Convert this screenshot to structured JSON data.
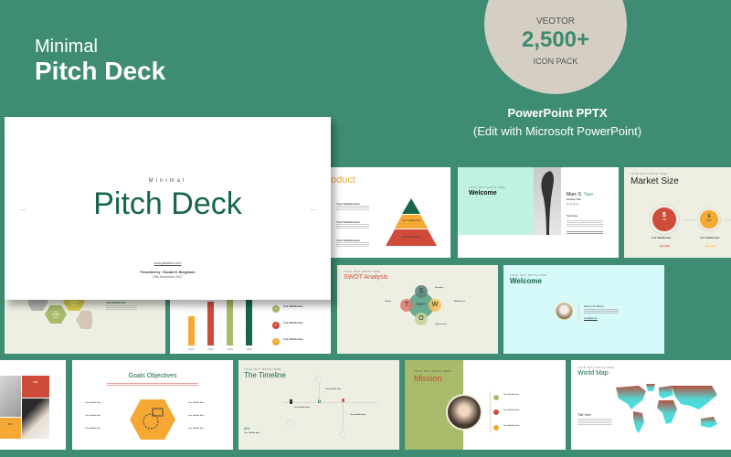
{
  "header": {
    "line1": "Minimal",
    "line2": "Pitch Deck"
  },
  "badge": {
    "top": "VEOTOR",
    "number": "2,500+",
    "bottom": "ICON PACK"
  },
  "format": {
    "title": "PowerPoint PPTX",
    "subtitle": "(Edit with Microsoft PowerPoint)"
  },
  "colors": {
    "background": "#3f8c74",
    "green_dark": "#17664a",
    "orange": "#f5a833",
    "red": "#cf4b3a",
    "olive": "#a8bb6a",
    "mint": "#bff2e3",
    "cyan": "#d6f9f9",
    "cream": "#eeefe3"
  },
  "cover": {
    "eyebrow": "Minimal",
    "title": "Pitch Deck",
    "url": "www.jakadeck.com",
    "presenter": "Presented by : Ronald D. Bergstrom",
    "date": "23th December 2027"
  },
  "slides": {
    "product": {
      "title": "oduct",
      "items": [
        "Your Subtitle Here",
        "Your Subtitle Here",
        "Your Subtitle Here"
      ],
      "pyramid": [
        "Your Subtitle Here",
        "Your Subtitle Here",
        "Your Subtitle Here"
      ]
    },
    "welcome1": {
      "eyebrow": "YOUR TEXT WRITE HERE",
      "title": "Welcome",
      "name_first": "Marc S.",
      "name_last": "Tape",
      "role": "Position Title",
      "section": "Message"
    },
    "market": {
      "eyebrow": "YOUR TEXT WRITE HERE",
      "title": "Market Size",
      "circles": [
        {
          "symbol": "$",
          "value": "70M",
          "label": "Your Subtitle Here",
          "tag": "Size 2022"
        },
        {
          "symbol": "$",
          "value": "50M",
          "label": "Your Subtitle Here",
          "tag": "Size 2023"
        }
      ]
    },
    "hex": {
      "hexes": [
        "Your Subtitle Here",
        "Your Subtitle Here",
        "Your Subtitle Here"
      ],
      "items": [
        "Your Subtitle Here",
        "Your Subtitle Here",
        "Your Subtitle Here"
      ]
    },
    "bars": {
      "categories": [
        "2021",
        "2022",
        "2023",
        "2024"
      ],
      "values": [
        2,
        3,
        4,
        5
      ],
      "items": [
        "Your Subtitle Here",
        "Your Subtitle Here",
        "Your Subtitle Here"
      ]
    },
    "swot": {
      "eyebrow": "YOUR TEXT WRITE HERE",
      "title": "SWOT Analysis",
      "center": "SWOT",
      "letters": [
        "S",
        "W",
        "O",
        "T"
      ],
      "labels": [
        "Strengths",
        "Weaknesses",
        "Opportunities",
        "Threats"
      ]
    },
    "welcome2": {
      "eyebrow": "YOUR TEXT WRITE HERE",
      "title": "Welcome",
      "name": "Sherry R. Moery",
      "contact": "Contact Us"
    },
    "team": {
      "tags": [
        "60K",
        "60K"
      ]
    },
    "goals": {
      "title": "Goals Objectives",
      "items_left": [
        "Your Subtitle Here",
        "Your Subtitle Here",
        "Your Subtitle Here"
      ],
      "items_right": [
        "Your Subtitle Here",
        "Your Subtitle Here",
        "Your Subtitle Here"
      ]
    },
    "timeline": {
      "eyebrow": "YOUR TEXT WRITE HERE",
      "title": "The Timeline",
      "step": "#01",
      "items": [
        "Your Subtitle Here",
        "Your Subtitle Here",
        "Your Subtitle Here",
        "Your Subtitle Here"
      ]
    },
    "mission": {
      "eyebrow": "YOUR TEXT WRITE HERE",
      "title": "Mission",
      "items": [
        "Your Subtitle Here",
        "Your Subtitle Here",
        "Your Subtitle Here"
      ]
    },
    "worldmap": {
      "eyebrow": "YOUR TEXT WRITE HERE",
      "title": "World Map",
      "label": "Title Here"
    }
  }
}
